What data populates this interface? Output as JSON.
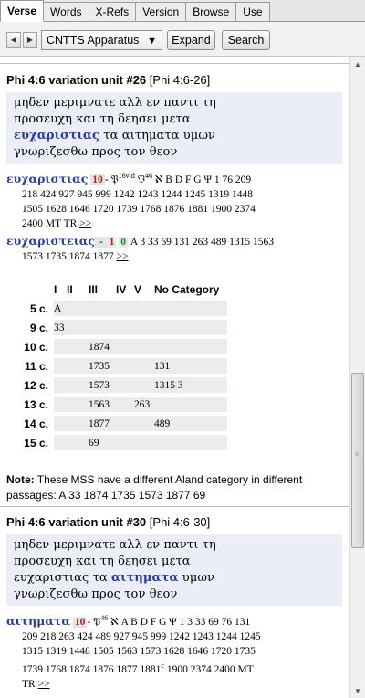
{
  "tabs": [
    "Verse",
    "Words",
    "X-Refs",
    "Version",
    "Browse",
    "Use"
  ],
  "toolbar": {
    "back_icon": "back-arrow-icon",
    "forward_icon": "forward-arrow-icon",
    "resource": "CNTTS Apparatus",
    "expand_label": "Expand",
    "search_label": "Search"
  },
  "unit26": {
    "title": "Phi 4:6 variation unit #26",
    "ref": "[Phi 4:6-26]",
    "greek": [
      [
        {
          "t": "μηδεν μεριμνατε αλλ εν παντι τη"
        }
      ],
      [
        {
          "t": "προσευχη και τη δεησει μετα"
        }
      ],
      [
        {
          "t": "ευχαριστιας",
          "hl": true
        },
        {
          "t": " τα αιτηματα υμων"
        }
      ],
      [
        {
          "t": "γνωριζεσθω προς τον θεον"
        }
      ]
    ],
    "reading1": {
      "word": "ευχαριστιας",
      "code": "10",
      "mss1": "- 𝔓",
      "sup1": "16vid",
      "mss2": " 𝔓",
      "sup2": "46",
      "mss3": " ℵ B D F G Ψ 1 76 209",
      "line2": "218 424 927 945 999 1242 1243 1244 1245 1319 1448",
      "line3": "1505 1628 1646 1720 1739 1768 1876 1881 1900 2374",
      "line4": "2400 MT TR",
      "more": ">>"
    },
    "reading2": {
      "word": "ευχαριστειας",
      "dash": " - ",
      "code1": "1",
      "code2": "0",
      "mss": "A 3 33 69 131 263 489 1315 1563",
      "line2": "1573 1735 1874 1877",
      "more": ">>"
    },
    "aland": {
      "headers": [
        "I",
        "II",
        "III",
        "IV",
        "V",
        "No Category"
      ],
      "rows": [
        {
          "c": "5 c.",
          "cells": [
            "A",
            "",
            "",
            "",
            "",
            ""
          ]
        },
        {
          "c": "9 c.",
          "cells": [
            "33",
            "",
            "",
            "",
            "",
            ""
          ]
        },
        {
          "c": "10 c.",
          "cells": [
            "",
            "",
            "1874",
            "",
            "",
            ""
          ]
        },
        {
          "c": "11 c.",
          "cells": [
            "",
            "",
            "1735",
            "",
            "",
            "131"
          ]
        },
        {
          "c": "12 c.",
          "cells": [
            "",
            "",
            "1573",
            "",
            "",
            "1315 3"
          ]
        },
        {
          "c": "13 c.",
          "cells": [
            "",
            "",
            "1563",
            "",
            "263",
            ""
          ]
        },
        {
          "c": "14 c.",
          "cells": [
            "",
            "",
            "1877",
            "",
            "",
            "489"
          ]
        },
        {
          "c": "15 c.",
          "cells": [
            "",
            "",
            "69",
            "",
            "",
            ""
          ]
        }
      ]
    },
    "note_label": "Note:",
    "note_text": " These MSS have a different Aland category in different passages: A 33 1874 1735 1573 1877 69"
  },
  "unit30": {
    "title": "Phi 4:6 variation unit #30",
    "ref": "[Phi 4:6-30]",
    "greek": [
      [
        {
          "t": "μηδεν μεριμνατε αλλ εν παντι τη"
        }
      ],
      [
        {
          "t": "προσευχη και τη δεησει μετα"
        }
      ],
      [
        {
          "t": "ευχαριστιας τα "
        },
        {
          "t": "αιτηματα",
          "hl": true
        },
        {
          "t": " υμων"
        }
      ],
      [
        {
          "t": "γνωριζεσθω προς τον θεον"
        }
      ]
    ],
    "reading1": {
      "word": "αιτηματα",
      "code": "10",
      "mss1": "- 𝔓",
      "sup1": "46",
      "mss2": " ℵ A B D F G Ψ 1 3 33 69 76 131",
      "line2": "209 218 263 424 489 927 945 999 1242 1243 1244 1245",
      "line3": "1315 1319 1448 1505 1563 1573 1628 1646 1720 1735",
      "line4a": "1739 1768 1874 1876 1877 1881",
      "sup3": "c",
      "line4b": " 1900 2374 2400 MT",
      "line5": "TR",
      "more": ">>"
    }
  }
}
